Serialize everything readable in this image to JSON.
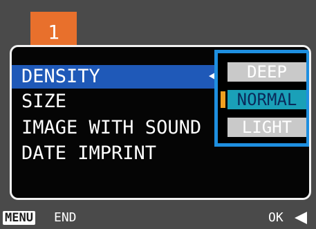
{
  "tab": {
    "number": "1",
    "color": "#e8702c"
  },
  "menu": {
    "items": [
      {
        "label": "DENSITY"
      },
      {
        "label": "SIZE"
      },
      {
        "label": "IMAGE WITH SOUND"
      },
      {
        "label": "DATE IMPRINT"
      }
    ],
    "selected_color": "#1f59b8"
  },
  "options": {
    "items": [
      {
        "label": "DEEP"
      },
      {
        "label": "NORMAL"
      },
      {
        "label": "LIGHT"
      }
    ],
    "selected": "NORMAL",
    "highlight_border_color": "#1e8fe0"
  },
  "footer": {
    "menu_badge": "MENU",
    "end_label": "END",
    "ok_label": "OK",
    "ok_icon": "left-arrow-icon"
  }
}
